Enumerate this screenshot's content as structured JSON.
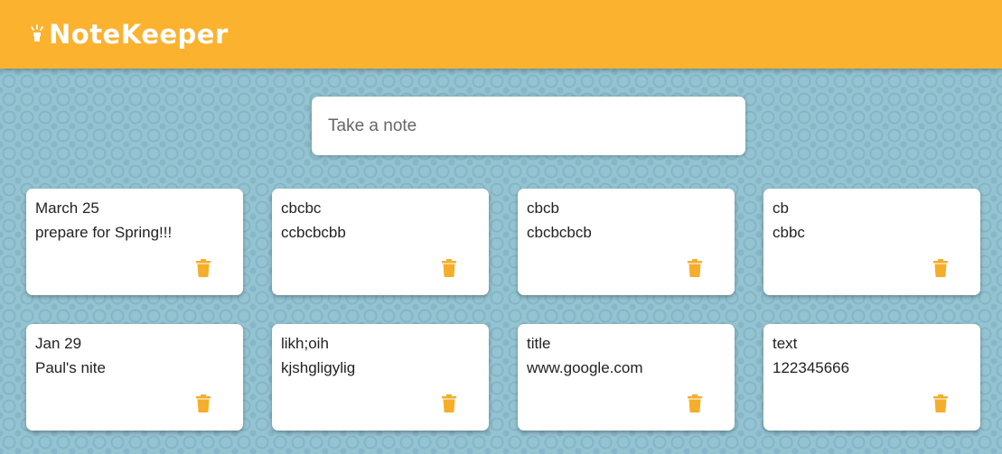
{
  "app": {
    "title": "NoteKeeper",
    "accent_color": "#fbb22f",
    "logo_icon": "lightbulb-icon"
  },
  "create_area": {
    "placeholder": "Take a note"
  },
  "notes": [
    {
      "title": "March 25",
      "content": "prepare for Spring!!!",
      "delete_icon": "trash-icon"
    },
    {
      "title": "cbcbc",
      "content": "ccbcbcbb",
      "delete_icon": "trash-icon"
    },
    {
      "title": "cbcb",
      "content": "cbcbcbcb",
      "delete_icon": "trash-icon"
    },
    {
      "title": "cb",
      "content": "cbbc",
      "delete_icon": "trash-icon"
    },
    {
      "title": "Jan 29",
      "content": "Paul's nite",
      "delete_icon": "trash-icon"
    },
    {
      "title": "likh;oih",
      "content": "kjshgligylig",
      "delete_icon": "trash-icon"
    },
    {
      "title": "title",
      "content": "www.google.com",
      "delete_icon": "trash-icon"
    },
    {
      "title": "text",
      "content": "122345666",
      "delete_icon": "trash-icon"
    }
  ]
}
